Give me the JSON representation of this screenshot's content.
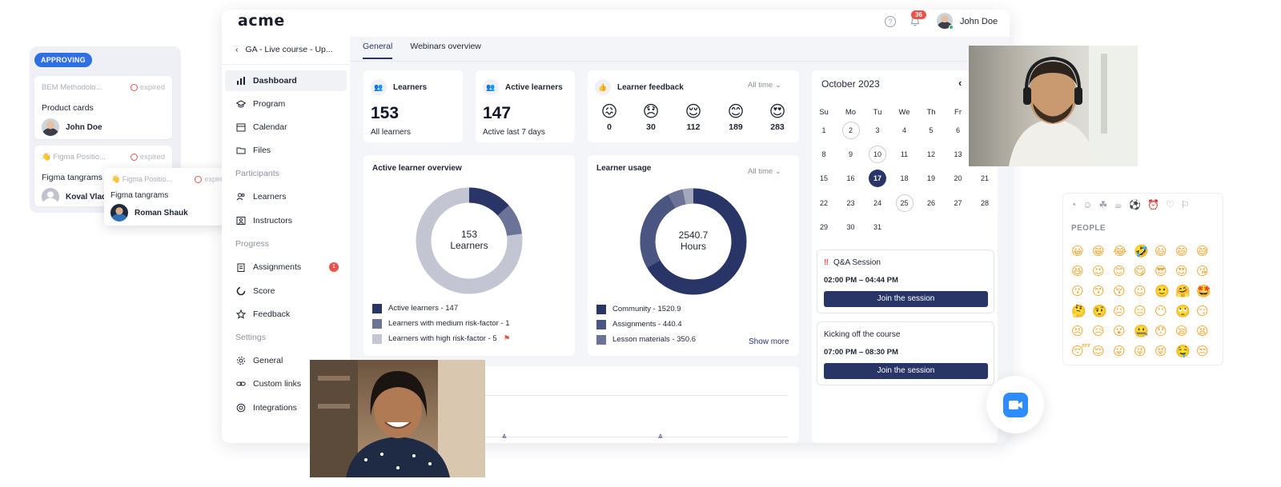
{
  "approving_board": {
    "badge": "APPROVING",
    "cards": [
      {
        "course": "BEM Methodolo...",
        "status": "expired",
        "title": "Product cards",
        "assignee": "John Doe"
      },
      {
        "course": "Figma Positio...",
        "status": "expired",
        "title": "Figma tangrams",
        "assignee": "Koval Vlad"
      }
    ],
    "floating_card": {
      "course": "Figma Positio...",
      "status": "expired",
      "title": "Figma tangrams",
      "assignee": "Roman Shauk"
    }
  },
  "app": {
    "logo": "acme",
    "notifications": "36",
    "user": "John Doe",
    "course_title": "GA - Live course - Up...",
    "nav": {
      "main": [
        "Dashboard",
        "Program",
        "Calendar",
        "Files"
      ],
      "participants_label": "Participants",
      "participants": [
        "Learners",
        "Instructors"
      ],
      "progress_label": "Progress",
      "progress": [
        "Assignments",
        "Score",
        "Feedback"
      ],
      "assignments_badge": "1",
      "settings_label": "Settings",
      "settings": [
        "General",
        "Custom links",
        "Integrations"
      ]
    },
    "tabs": [
      "General",
      "Webinars overview"
    ],
    "stats": {
      "learners": {
        "label": "Learners",
        "value": "153",
        "sub": "All learners"
      },
      "active": {
        "label": "Active learners",
        "value": "147",
        "sub": "Active last 7 days"
      }
    },
    "feedback": {
      "label": "Learner feedback",
      "filter": "All time",
      "items": [
        {
          "icon": "angry-face",
          "count": "0"
        },
        {
          "icon": "sad-face",
          "count": "30"
        },
        {
          "icon": "relieved-face",
          "count": "112"
        },
        {
          "icon": "smiling-face",
          "count": "189"
        },
        {
          "icon": "heart-eyes-face",
          "count": "283"
        }
      ]
    },
    "active_overview": {
      "title": "Active learner overview",
      "center_value": "153",
      "center_label": "Learners",
      "legend": [
        "Active learners - 147",
        "Learners with medium risk-factor - 1",
        "Learners with high risk-factor - 5"
      ],
      "colors": [
        "#2a3567",
        "#6b7396",
        "#c3c6d2"
      ]
    },
    "usage": {
      "title": "Learner usage",
      "filter": "All time",
      "center_value": "2540.7",
      "center_label": "Hours",
      "legend": [
        "Community - 1520.9",
        "Assignments - 440.4",
        "Lesson materials - 350.6"
      ],
      "colors": [
        "#2a3567",
        "#4b5582",
        "#6b7396"
      ],
      "show_more": "Show more"
    },
    "calendar": {
      "month": "October 2023",
      "weekdays": [
        "Su",
        "Mo",
        "Tu",
        "We",
        "Th",
        "Fr",
        "Sa"
      ],
      "days": [
        "1",
        "2",
        "3",
        "4",
        "5",
        "6",
        "7",
        "8",
        "9",
        "10",
        "11",
        "12",
        "13",
        "14",
        "15",
        "16",
        "17",
        "18",
        "19",
        "20",
        "21",
        "22",
        "23",
        "24",
        "25",
        "26",
        "27",
        "28",
        "29",
        "30",
        "31"
      ],
      "today": "17",
      "marked": [
        "2",
        "10",
        "25"
      ]
    },
    "sessions": [
      {
        "title": "Q&A Session",
        "time": "02:00 PM – 04:44 PM",
        "button": "Join the session"
      },
      {
        "title": "Kicking off the course",
        "time": "07:00 PM – 08:30 PM",
        "button": "Join the session"
      }
    ]
  },
  "emoji_picker": {
    "category_label": "PEOPLE",
    "emojis": [
      "😀",
      "😁",
      "😂",
      "🤣",
      "😃",
      "😄",
      "😅",
      "😆",
      "😉",
      "😊",
      "😋",
      "😎",
      "😍",
      "😘",
      "😗",
      "😙",
      "😚",
      "☺",
      "🙂",
      "🤗",
      "🤩",
      "🤔",
      "🤨",
      "😐",
      "😑",
      "😶",
      "🙄",
      "😏",
      "😣",
      "😥",
      "😮",
      "🤐",
      "😯",
      "😪",
      "😫",
      "😴",
      "😌",
      "😛",
      "😜",
      "😝",
      "🤤",
      "😒"
    ]
  },
  "colors": {
    "primary": "#2a3567",
    "badge": "#e9524a",
    "approving": "#2f6fe4",
    "zoom": "#2d8cff"
  }
}
